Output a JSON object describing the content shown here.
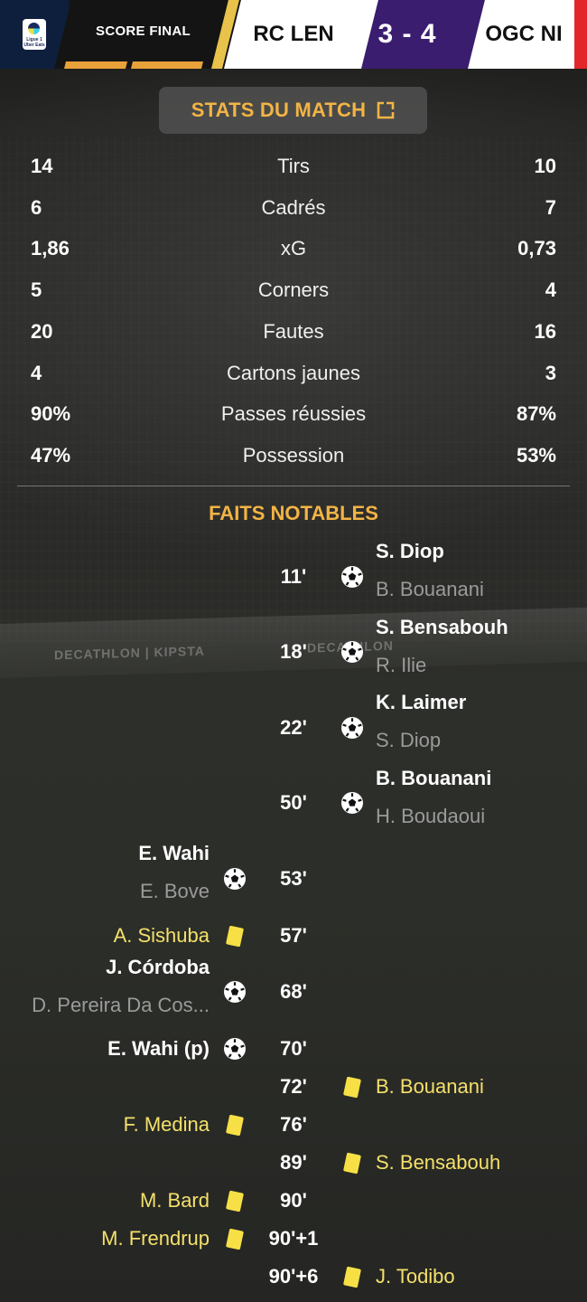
{
  "header": {
    "league_logo_text": "Ligue 1 Uber Eats",
    "status": "SCORE FINAL",
    "home_team": "RC LEN",
    "score": "3 - 4",
    "away_team": "OGC NI"
  },
  "stats_button": {
    "label": "STATS DU MATCH",
    "icon": "external-link-icon"
  },
  "stats": [
    {
      "home": "14",
      "label": "Tirs",
      "away": "10"
    },
    {
      "home": "6",
      "label": "Cadrés",
      "away": "7"
    },
    {
      "home": "1,86",
      "label": "xG",
      "away": "0,73"
    },
    {
      "home": "5",
      "label": "Corners",
      "away": "4"
    },
    {
      "home": "20",
      "label": "Fautes",
      "away": "16"
    },
    {
      "home": "4",
      "label": "Cartons jaunes",
      "away": "3"
    },
    {
      "home": "90%",
      "label": "Passes réussies",
      "away": "87%"
    },
    {
      "home": "47%",
      "label": "Possession",
      "away": "53%"
    }
  ],
  "background_board": {
    "left": "DECATHLON | KIPSTA",
    "right": "DECATHLON"
  },
  "faits_title": "FAITS NOTABLES",
  "events": [
    {
      "minute": "11'",
      "side": "away",
      "type": "goal",
      "player": "S. Diop",
      "assist": "B. Bouanani"
    },
    {
      "minute": "18'",
      "side": "away",
      "type": "goal",
      "player": "S. Bensabouh",
      "assist": "R. Ilie"
    },
    {
      "minute": "22'",
      "side": "away",
      "type": "goal",
      "player": "K. Laimer",
      "assist": "S. Diop"
    },
    {
      "minute": "50'",
      "side": "away",
      "type": "goal",
      "player": "B. Bouanani",
      "assist": "H. Boudaoui"
    },
    {
      "minute": "53'",
      "side": "home",
      "type": "goal",
      "player": "E. Wahi",
      "assist": "E. Bove"
    },
    {
      "minute": "57'",
      "side": "home",
      "type": "yellow",
      "player": "A. Sishuba"
    },
    {
      "minute": "68'",
      "side": "home",
      "type": "goal",
      "player": "J. Córdoba",
      "assist": "D. Pereira Da Cos..."
    },
    {
      "minute": "70'",
      "side": "home",
      "type": "goal",
      "player": "E. Wahi (p)"
    },
    {
      "minute": "72'",
      "side": "away",
      "type": "yellow",
      "player": "B. Bouanani"
    },
    {
      "minute": "76'",
      "side": "home",
      "type": "yellow",
      "player": "F. Medina"
    },
    {
      "minute": "89'",
      "side": "away",
      "type": "yellow",
      "player": "S. Bensabouh"
    },
    {
      "minute": "90'",
      "side": "home",
      "type": "yellow",
      "player": "M. Bard"
    },
    {
      "minute": "90'+1",
      "side": "home",
      "type": "yellow",
      "player": "M. Frendrup"
    },
    {
      "minute": "90'+6",
      "side": "away",
      "type": "yellow",
      "player": "J. Todibo"
    }
  ]
}
